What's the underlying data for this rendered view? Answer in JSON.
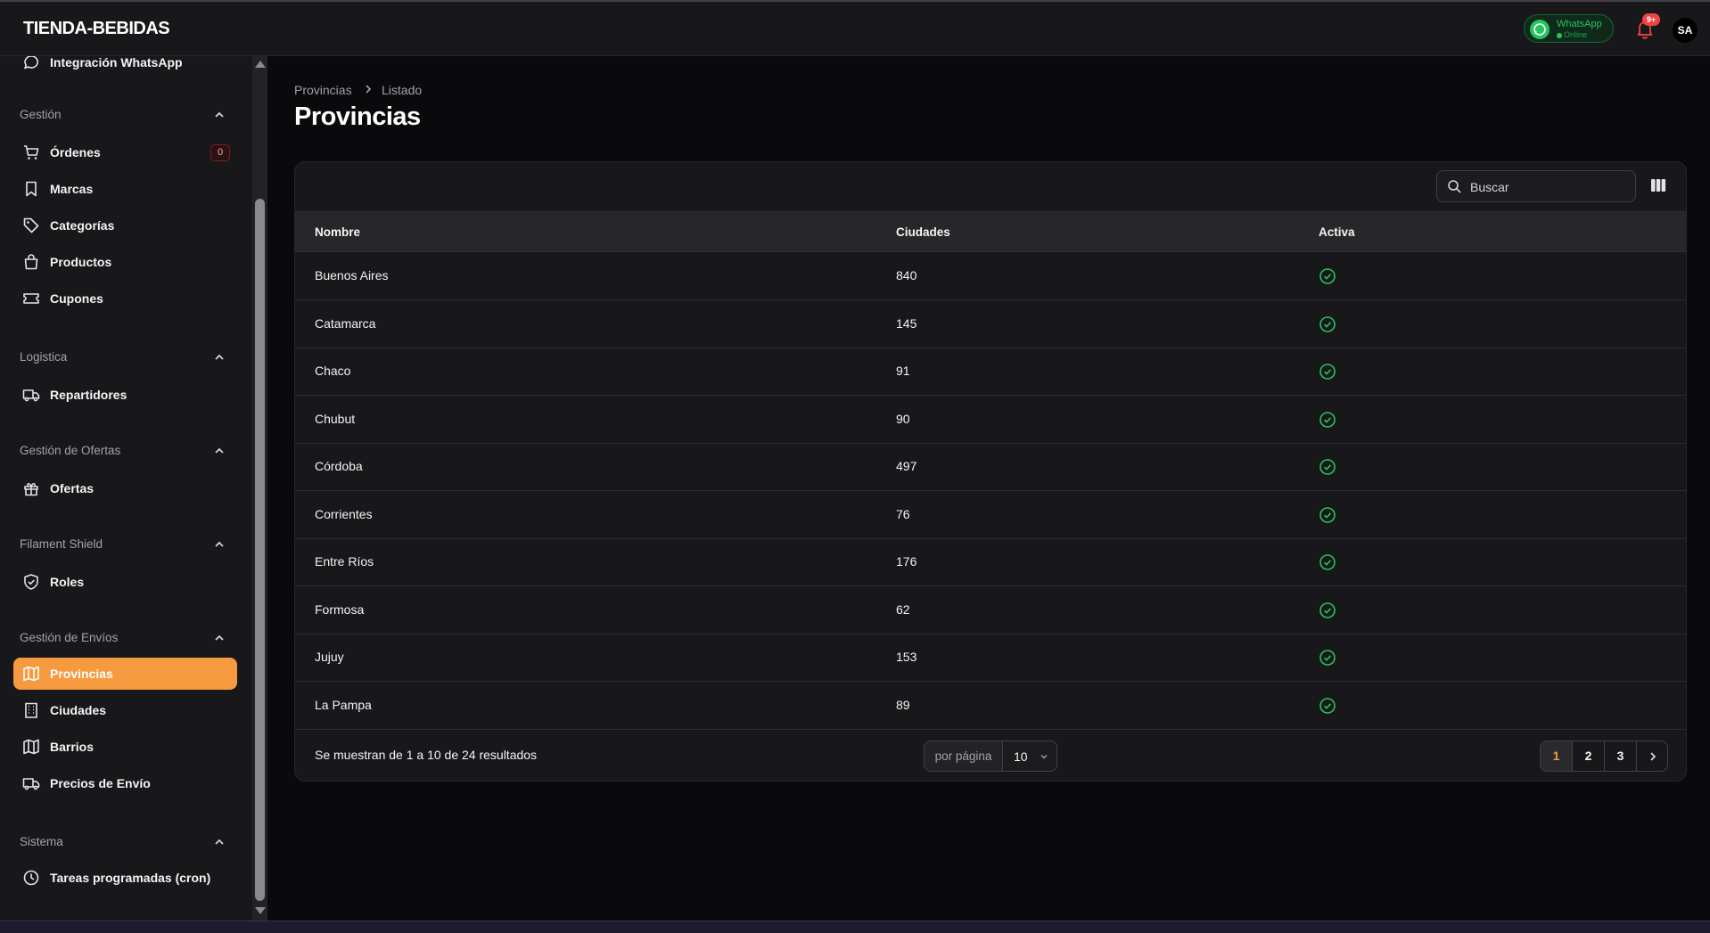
{
  "app": {
    "brand": "TIENDA-BEBIDAS"
  },
  "topbar": {
    "whatsapp_title": "WhatsApp",
    "whatsapp_status": "Online",
    "notifications_badge": "9+",
    "avatar_initials": "SA"
  },
  "sidebar": {
    "partial_item": "Integración WhatsApp",
    "groups": {
      "gestion": "Gestión",
      "logistica": "Logistica",
      "ofertas": "Gestión de Ofertas",
      "shield": "Filament Shield",
      "envios": "Gestión de Envíos",
      "sistema": "Sistema"
    },
    "items": {
      "ordenes": "Órdenes",
      "ordenes_badge": "0",
      "marcas": "Marcas",
      "categorias": "Categorías",
      "productos": "Productos",
      "cupones": "Cupones",
      "repartidores": "Repartidores",
      "ofertas": "Ofertas",
      "roles": "Roles",
      "provincias": "Provincias",
      "ciudades": "Ciudades",
      "barrios": "Barrios",
      "precios_envio": "Precios de Envío",
      "tareas": "Tareas programadas (cron)"
    }
  },
  "breadcrumb": {
    "parent": "Provincias",
    "current": "Listado"
  },
  "page": {
    "title": "Provincias"
  },
  "search": {
    "placeholder": "Buscar"
  },
  "table": {
    "columns": {
      "nombre": "Nombre",
      "ciudades": "Ciudades",
      "activa": "Activa"
    },
    "rows": [
      {
        "nombre": "Buenos Aires",
        "ciudades": "840",
        "activa": true
      },
      {
        "nombre": "Catamarca",
        "ciudades": "145",
        "activa": true
      },
      {
        "nombre": "Chaco",
        "ciudades": "91",
        "activa": true
      },
      {
        "nombre": "Chubut",
        "ciudades": "90",
        "activa": true
      },
      {
        "nombre": "Córdoba",
        "ciudades": "497",
        "activa": true
      },
      {
        "nombre": "Corrientes",
        "ciudades": "76",
        "activa": true
      },
      {
        "nombre": "Entre Ríos",
        "ciudades": "176",
        "activa": true
      },
      {
        "nombre": "Formosa",
        "ciudades": "62",
        "activa": true
      },
      {
        "nombre": "Jujuy",
        "ciudades": "153",
        "activa": true
      },
      {
        "nombre": "La Pampa",
        "ciudades": "89",
        "activa": true
      }
    ]
  },
  "footer": {
    "summary": "Se muestran de 1 a 10 de 24 resultados",
    "per_page_label": "por página",
    "per_page_value": "10",
    "pages": [
      "1",
      "2",
      "3"
    ],
    "current_page": "1"
  },
  "colors": {
    "accent": "#f59a3e",
    "success": "#22c55e",
    "danger": "#ef4444"
  }
}
